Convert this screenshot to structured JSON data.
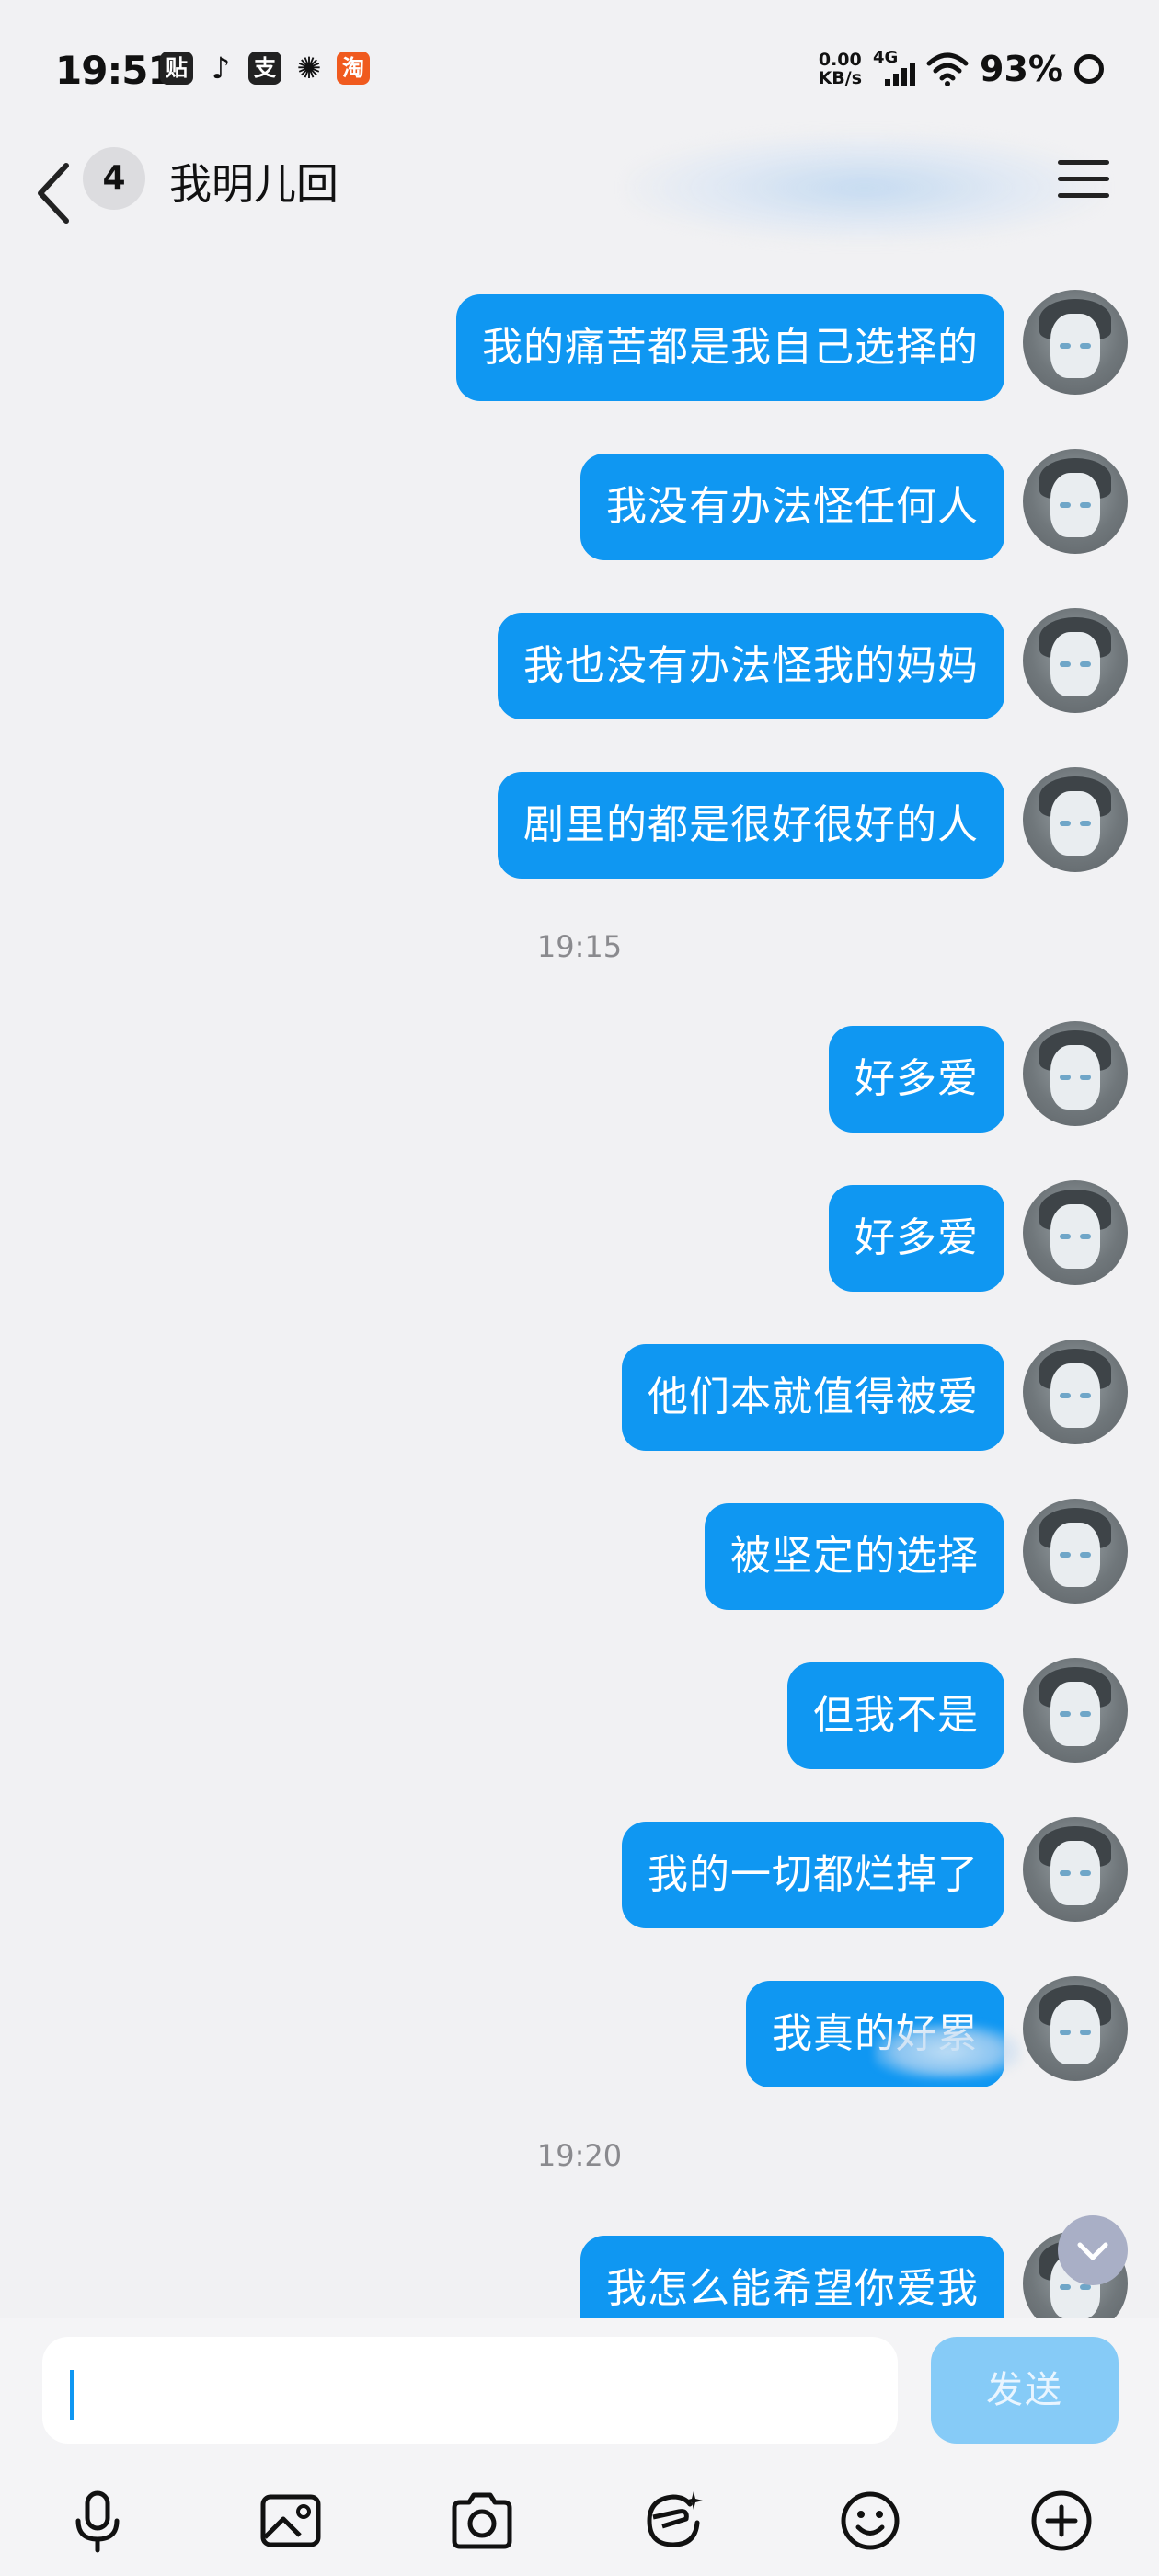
{
  "status_bar": {
    "time": "19:51",
    "speed_value": "0.00",
    "speed_unit": "KB/s",
    "network": "4G",
    "battery": "93%",
    "app_icons": [
      "贴",
      "tiktok",
      "支",
      "wechat",
      "淘"
    ]
  },
  "header": {
    "unread_count": "4",
    "title": "我明儿回"
  },
  "messages": [
    {
      "text": "我的痛苦都是我自己选择的"
    },
    {
      "text": "我没有办法怪任何人"
    },
    {
      "text": "我也没有办法怪我的妈妈"
    },
    {
      "text": "剧里的都是很好很好的人"
    },
    {
      "timestamp": "19:15"
    },
    {
      "text": "好多爱"
    },
    {
      "text": "好多爱"
    },
    {
      "text": "他们本就值得被爱"
    },
    {
      "text": "被坚定的选择"
    },
    {
      "text": "但我不是"
    },
    {
      "text": "我的一切都烂掉了"
    },
    {
      "text": "我真的好累"
    },
    {
      "timestamp": "19:20"
    },
    {
      "text": "我怎么能希望你爱我"
    }
  ],
  "input_bar": {
    "send_label": "发送",
    "input_value": "",
    "tools": [
      "microphone-icon",
      "image-icon",
      "camera-icon",
      "sticker-icon",
      "emoji-icon",
      "plus-icon"
    ]
  },
  "colors": {
    "bubble": "#0f97f2",
    "send_disabled": "#86cbf7",
    "background": "#f1f1f3"
  }
}
